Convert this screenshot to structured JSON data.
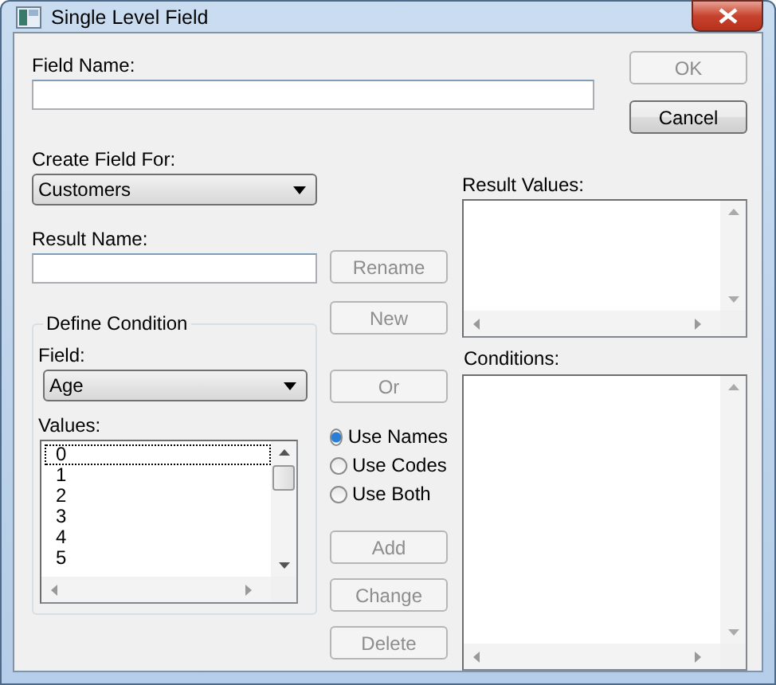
{
  "window": {
    "title": "Single Level Field"
  },
  "field_name": {
    "label": "Field Name:"
  },
  "dialog_buttons": [
    {
      "label": "OK",
      "disabled": true
    },
    {
      "label": "Cancel",
      "disabled": false
    }
  ],
  "create_field_for": {
    "label": "Create Field For:",
    "value": "Customers"
  },
  "result_name": {
    "label": "Result Name:"
  },
  "result_buttons": [
    {
      "label": "Rename",
      "disabled": true
    },
    {
      "label": "New",
      "disabled": true
    }
  ],
  "result_values": {
    "label": "Result Values:"
  },
  "define_condition": {
    "title": "Define Condition",
    "field": {
      "label": "Field:",
      "value": "Age"
    },
    "values": {
      "label": "Values:",
      "items": [
        {
          "text": "0",
          "focused": true
        },
        {
          "text": "1",
          "focused": false
        },
        {
          "text": "2",
          "focused": false
        },
        {
          "text": "3",
          "focused": false
        },
        {
          "text": "4",
          "focused": false
        },
        {
          "text": "5",
          "focused": false
        }
      ]
    }
  },
  "condition_buttons": [
    {
      "label": "Or",
      "disabled": true
    }
  ],
  "name_options": [
    {
      "label": "Use Names",
      "selected": true
    },
    {
      "label": "Use Codes",
      "selected": false
    },
    {
      "label": "Use Both",
      "selected": false
    }
  ],
  "edit_buttons": [
    {
      "label": "Add",
      "disabled": true
    },
    {
      "label": "Change",
      "disabled": true
    },
    {
      "label": "Delete",
      "disabled": true
    }
  ],
  "conditions": {
    "label": "Conditions:"
  }
}
